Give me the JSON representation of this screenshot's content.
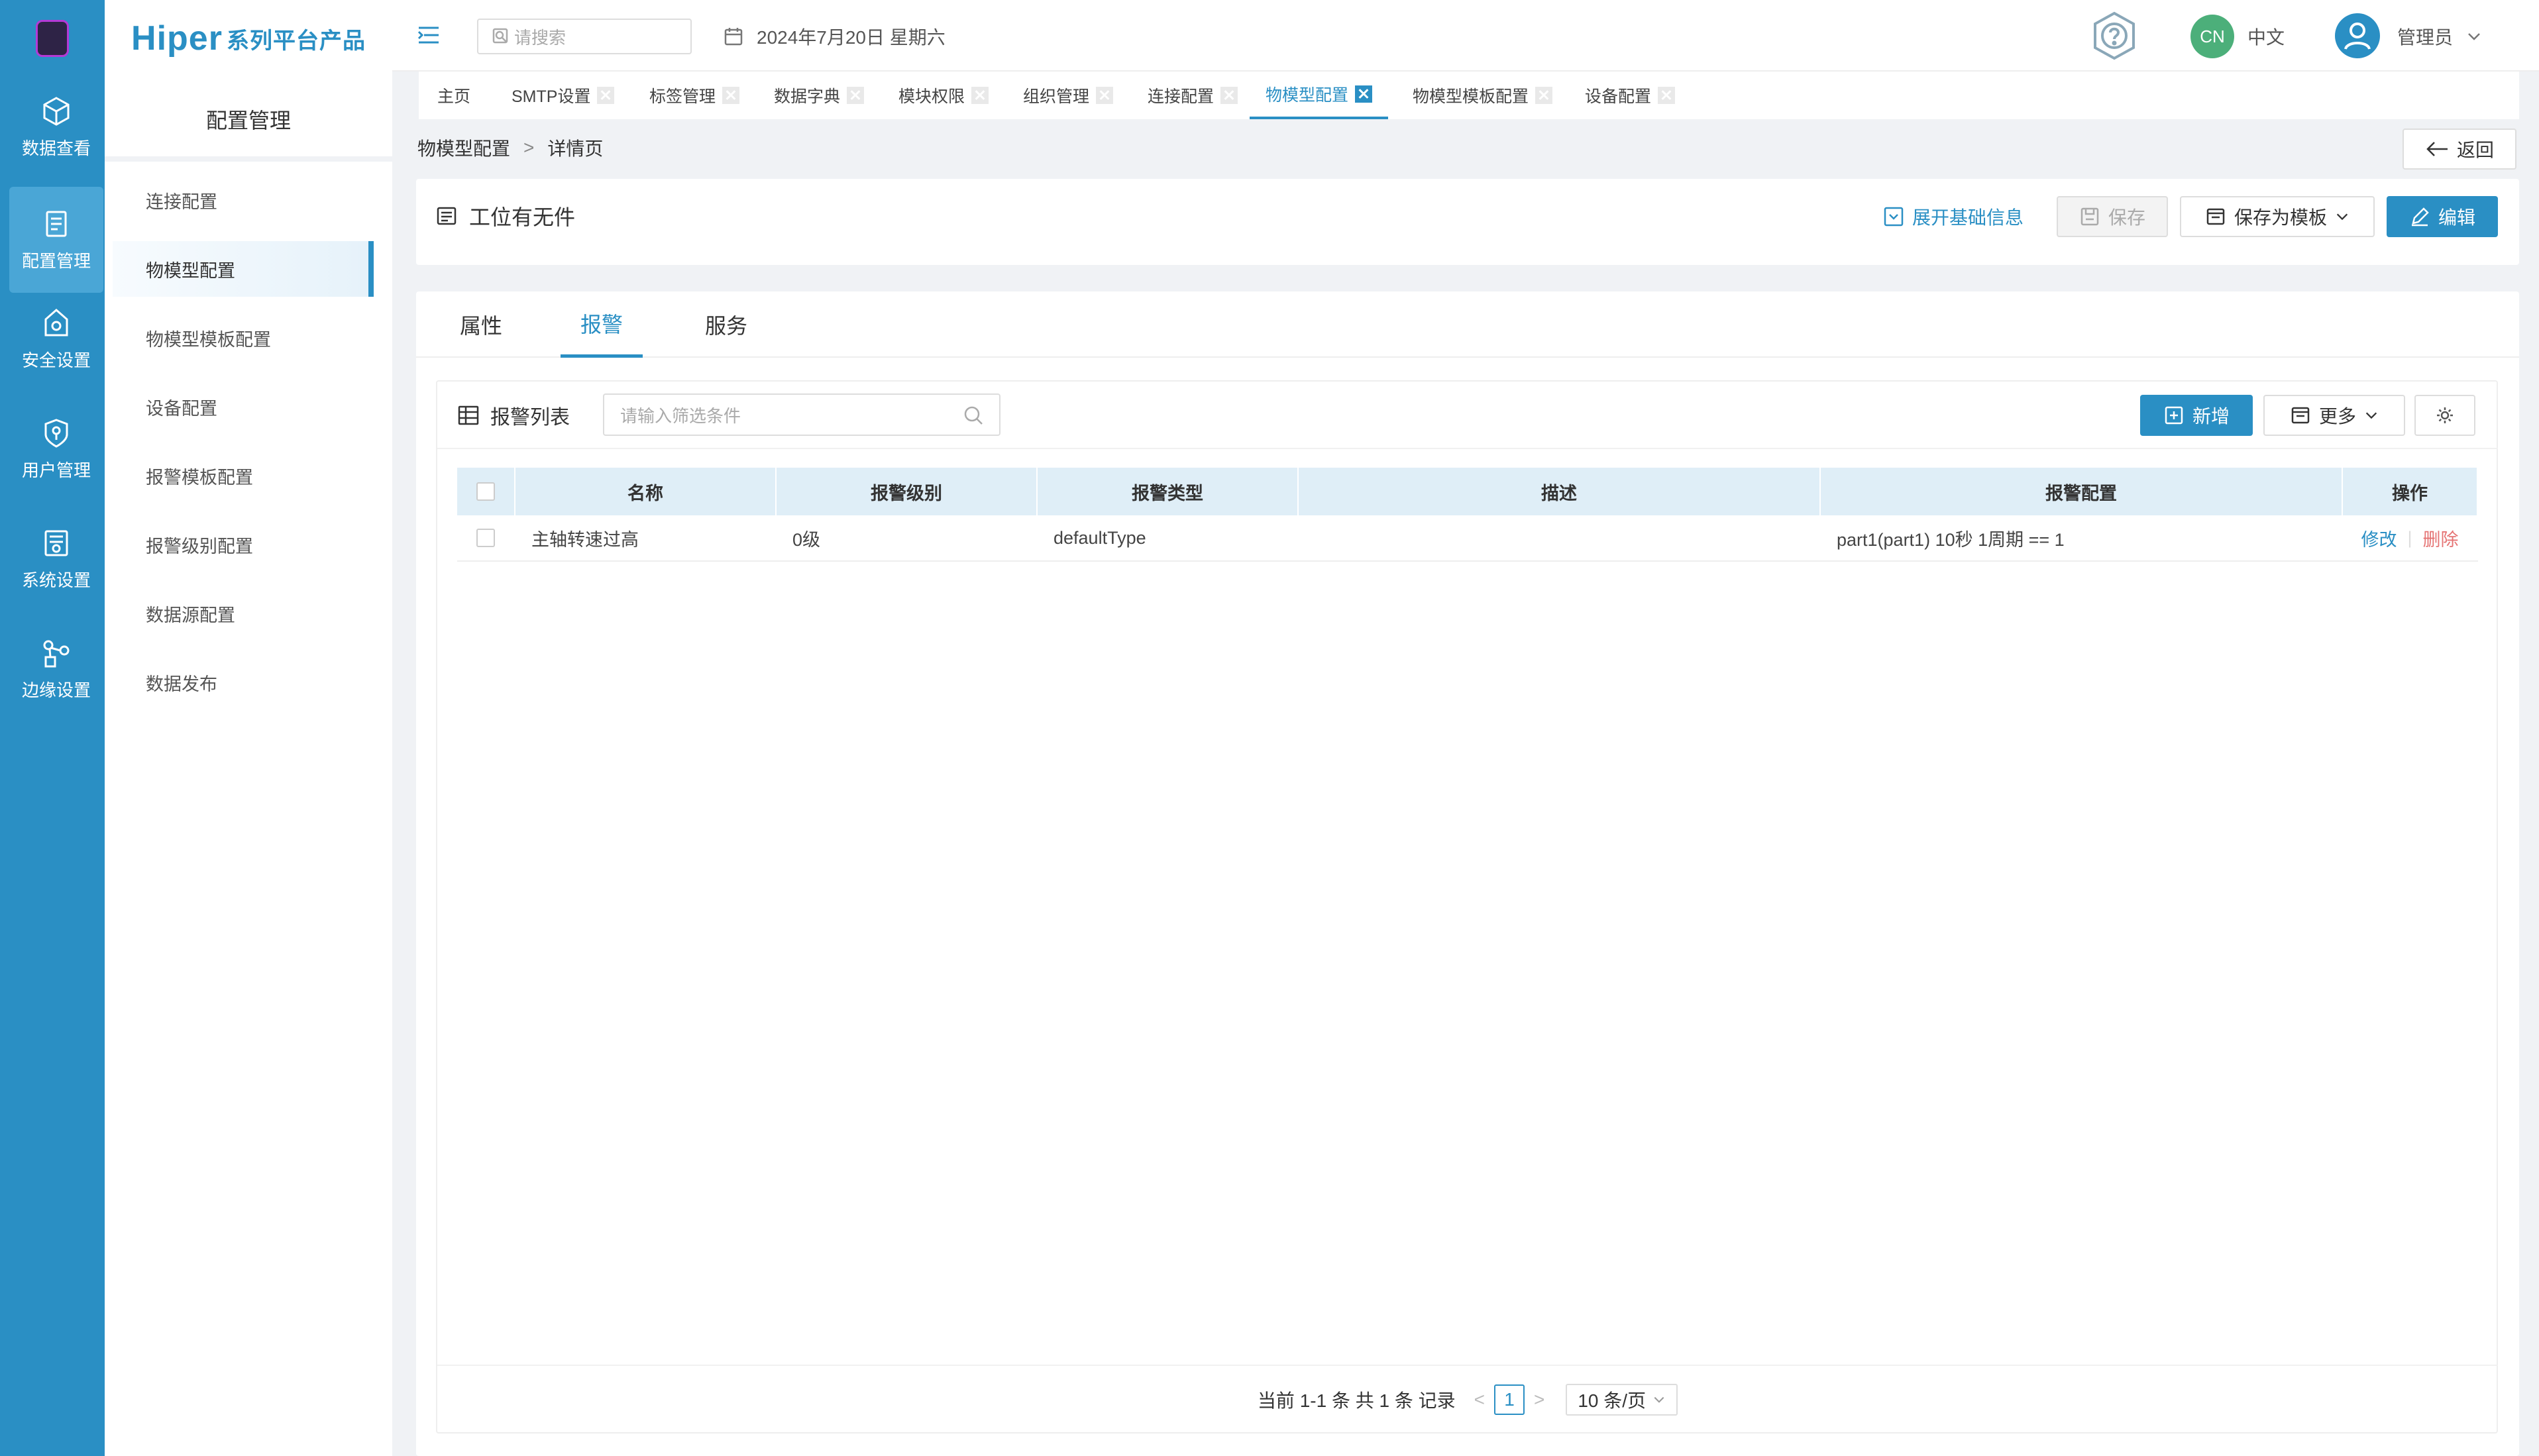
{
  "rail": {
    "items": [
      {
        "label": "数据查看",
        "icon": "cube-icon"
      },
      {
        "label": "配置管理",
        "icon": "config-icon",
        "active": true
      },
      {
        "label": "安全设置",
        "icon": "security-icon"
      },
      {
        "label": "用户管理",
        "icon": "user-shield-icon"
      },
      {
        "label": "系统设置",
        "icon": "system-icon"
      },
      {
        "label": "边缘设置",
        "icon": "edge-icon"
      }
    ]
  },
  "sidebar": {
    "brand": "Hiper",
    "brand_suffix": "系列平台产品",
    "title": "配置管理",
    "items": [
      {
        "label": "连接配置"
      },
      {
        "label": "物模型配置",
        "active": true
      },
      {
        "label": "物模型模板配置"
      },
      {
        "label": "设备配置"
      },
      {
        "label": "报警模板配置"
      },
      {
        "label": "报警级别配置"
      },
      {
        "label": "数据源配置"
      },
      {
        "label": "数据发布"
      }
    ]
  },
  "topbar": {
    "search_placeholder": "请搜索",
    "date": "2024年7月20日 星期六",
    "lang_badge": "CN",
    "lang": "中文",
    "user": "管理员"
  },
  "tabs": [
    {
      "label": "主页",
      "closable": false
    },
    {
      "label": "SMTP设置",
      "closable": true
    },
    {
      "label": "标签管理",
      "closable": true
    },
    {
      "label": "数据字典",
      "closable": true
    },
    {
      "label": "模块权限",
      "closable": true
    },
    {
      "label": "组织管理",
      "closable": true
    },
    {
      "label": "连接配置",
      "closable": true
    },
    {
      "label": "物模型配置",
      "closable": true,
      "active": true
    },
    {
      "label": "物模型模板配置",
      "closable": true
    },
    {
      "label": "设备配置",
      "closable": true
    }
  ],
  "breadcrumb": {
    "parent": "物模型配置",
    "separator": ">",
    "current": "详情页"
  },
  "back_label": "返回",
  "title_card": {
    "title": "工位有无件",
    "expand_label": "展开基础信息",
    "save_label": "保存",
    "save_template_label": "保存为模板",
    "edit_label": "编辑"
  },
  "subtabs": [
    {
      "label": "属性"
    },
    {
      "label": "报警",
      "active": true
    },
    {
      "label": "服务"
    }
  ],
  "panel": {
    "title": "报警列表",
    "filter_placeholder": "请输入筛选条件",
    "add_label": "新增",
    "more_label": "更多"
  },
  "table": {
    "columns": [
      "名称",
      "报警级别",
      "报警类型",
      "描述",
      "报警配置",
      "操作"
    ],
    "rows": [
      {
        "name": "主轴转速过高",
        "level": "0级",
        "type": "defaultType",
        "desc": "",
        "config": "part1(part1) 10秒 1周期 == 1",
        "edit": "修改",
        "delete": "删除"
      }
    ]
  },
  "pager": {
    "summary": "当前 1-1 条 共 1 条 记录",
    "prev": "<",
    "page": "1",
    "next": ">",
    "page_size": "10 条/页"
  },
  "colors": {
    "accent": "#2a8fc4",
    "rail": "#2a8fc4",
    "danger": "#e57373"
  }
}
